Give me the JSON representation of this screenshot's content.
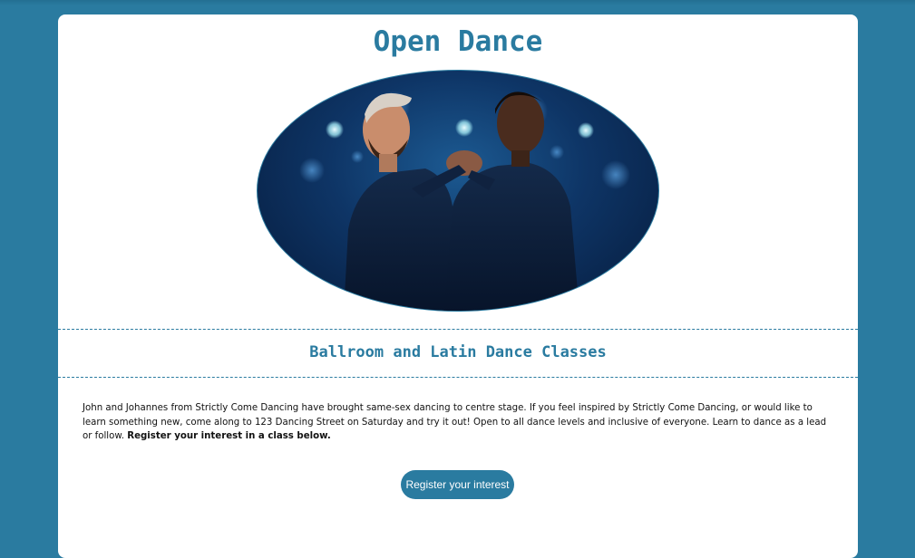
{
  "page": {
    "title": "Open Dance",
    "subtitle": "Ballroom and Latin Dance Classes",
    "description": "John and Johannes from Strictly Come Dancing have brought same-sex dancing to centre stage. If you feel inspired by Strictly Come Dancing, or would like to learn something new, come along to 123 Dancing Street on Saturday and try it out! Open to all dance levels and inclusive of everyone. Learn to dance as a lead or follow.",
    "description_emphasis": "Register your interest in a class below.",
    "cta_label": "Register your interest"
  },
  "colors": {
    "background": "#2a7ba0",
    "card": "#ffffff",
    "accent": "#2a7ba0",
    "text": "#111111"
  }
}
